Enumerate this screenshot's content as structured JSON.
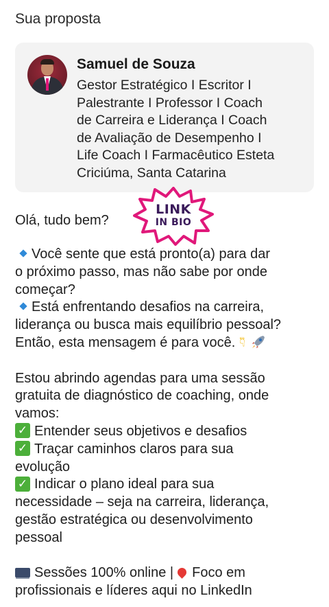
{
  "section_title": "Sua proposta",
  "profile": {
    "name": "Samuel de Souza",
    "bio_lines": [
      "Gestor Estratégico I Escritor I",
      "Palestrante I Professor I Coach",
      "de Carreira e Liderança I Coach",
      "de Avaliação de Desempenho I",
      "Life Coach I Farmacêutico Esteta",
      "Criciúma, Santa Catarina"
    ]
  },
  "sticker": {
    "line1": "LINK",
    "line2": "IN BIO",
    "color": "#e0187a"
  },
  "greeting": "Olá, tudo bem?",
  "message": {
    "q1_a": "Você sente que está pronto(a) para dar",
    "q1_b": "o próximo passo, mas não sabe por onde",
    "q1_c": "começar?",
    "q2_a": "Está enfrentando desafios na carreira,",
    "q2_b": "liderança ou busca mais equilíbrio pessoal?",
    "q2_c": "Então, esta mensagem é para você.",
    "p2_a": "Estou abrindo agendas para uma sessão",
    "p2_b": "gratuita de diagnóstico de coaching, onde",
    "p2_c": "vamos:",
    "c1": "Entender seus objetivos e desafios",
    "c2_a": "Traçar caminhos claros para sua",
    "c2_b": "evolução",
    "c3_a": "Indicar o plano ideal para sua",
    "c3_b": "necessidade – seja na carreira, liderança,",
    "c3_c": "gestão estratégica ou desenvolvimento",
    "c3_d": "pessoal",
    "f1_a": "Sessões 100% online |",
    "f1_b": "Foco em",
    "f2": "profissionais e líderes aqui no LinkedIn"
  },
  "icons": [
    "blue-diamond-icon",
    "check-mark-icon",
    "pointing-down-icon",
    "rocket-icon",
    "laptop-icon",
    "pin-icon"
  ]
}
